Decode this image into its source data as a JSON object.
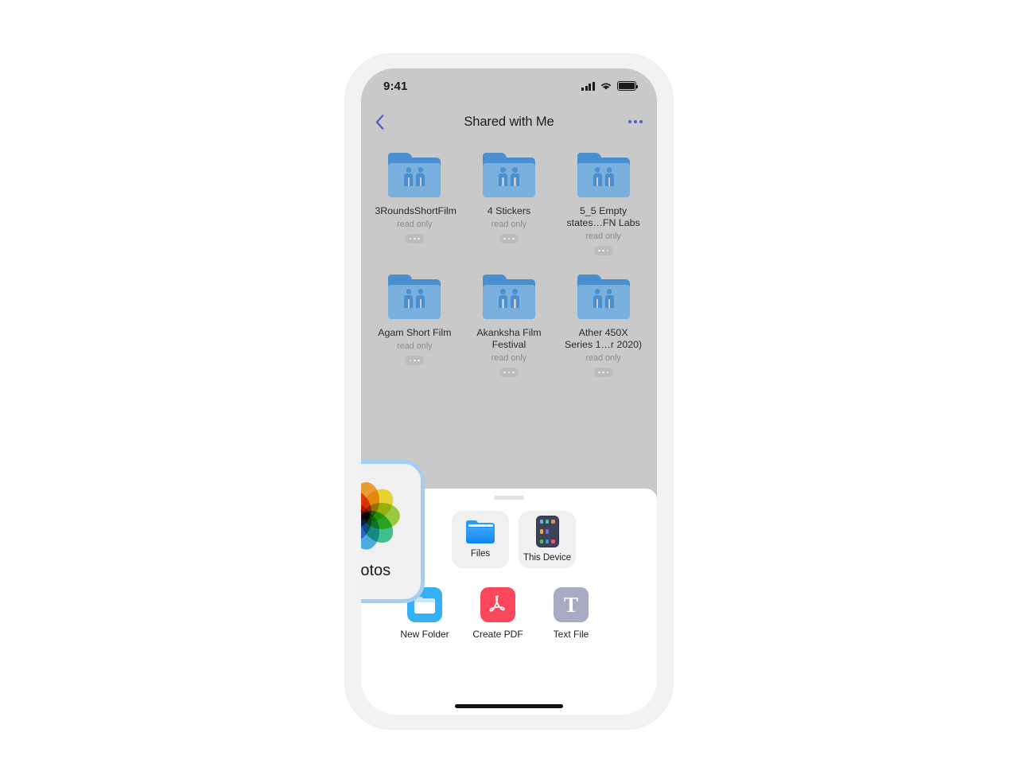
{
  "status_bar": {
    "time": "9:41",
    "signal_icon": "cellular-signal-icon",
    "wifi_icon": "wifi-icon",
    "battery_icon": "battery-full-icon"
  },
  "nav": {
    "back_icon": "chevron-left-icon",
    "title": "Shared with Me",
    "more_icon": "more-options-icon"
  },
  "folders": [
    {
      "name": "3RoundsShortFilm",
      "permission": "read only",
      "icon": "shared-folder-icon",
      "menu_icon": "ellipsis-icon"
    },
    {
      "name": "4 Stickers",
      "permission": "read only",
      "icon": "shared-folder-icon",
      "menu_icon": "ellipsis-icon"
    },
    {
      "name": "5_5 Empty states…FN Labs",
      "permission": "read only",
      "icon": "shared-folder-icon",
      "menu_icon": "ellipsis-icon"
    },
    {
      "name": "Agam Short Film",
      "permission": "read only",
      "icon": "shared-folder-icon",
      "menu_icon": "ellipsis-icon"
    },
    {
      "name": "Akanksha Film Festival",
      "permission": "read only",
      "icon": "shared-folder-icon",
      "menu_icon": "ellipsis-icon"
    },
    {
      "name": "Ather 450X Series 1…r 2020)",
      "permission": "read only",
      "icon": "shared-folder-icon",
      "menu_icon": "ellipsis-icon"
    }
  ],
  "sheet": {
    "grabber": "sheet-grabber",
    "sources": [
      {
        "label": "Photos",
        "icon": "photos-app-icon",
        "selected": true
      },
      {
        "label": "Files",
        "icon": "files-app-icon",
        "selected": false
      },
      {
        "label": "This Device",
        "icon": "this-device-icon",
        "selected": false
      }
    ],
    "actions": [
      {
        "label": "New Folder",
        "icon": "new-folder-icon"
      },
      {
        "label": "Create PDF",
        "icon": "create-pdf-icon"
      },
      {
        "label": "Text File",
        "icon": "text-file-icon"
      }
    ],
    "home_indicator": "home-indicator"
  },
  "colors": {
    "accent_blue": "#4a5fd0",
    "selection_border": "#a4cdf2",
    "folder_blue": "#4a90d0",
    "folder_light": "#79b0dd",
    "pdf_red": "#f9485b",
    "new_folder_blue": "#35b0f7",
    "text_file_gray": "#a7abc4",
    "screen_bg": "#c9c9c9",
    "sheet_bg": "#ffffff"
  },
  "photos_flower_colors": [
    "#f9a02c",
    "#f5e02b",
    "#9ed438",
    "#38c98f",
    "#47b3f0",
    "#8e8ce0",
    "#d561ae",
    "#f4565c"
  ]
}
